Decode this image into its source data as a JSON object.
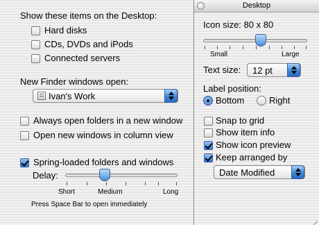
{
  "left": {
    "desktop_heading": "Show these items on the Desktop:",
    "desktop_items": [
      {
        "label": "Hard disks",
        "checked": false
      },
      {
        "label": "CDs, DVDs and iPods",
        "checked": false
      },
      {
        "label": "Connected servers",
        "checked": false
      }
    ],
    "new_window_label": "New Finder windows open:",
    "new_window_value": "Ivan's Work",
    "options": [
      {
        "label": "Always open folders in a new window",
        "checked": false
      },
      {
        "label": "Open new windows in column view",
        "checked": false
      },
      {
        "label": "Spring-loaded folders and windows",
        "checked": true
      }
    ],
    "delay_label": "Delay:",
    "delay_ticks": {
      "short": "Short",
      "medium": "Medium",
      "long": "Long"
    },
    "delay_value_fraction": 0.35,
    "hint": "Press Space Bar to open immediately"
  },
  "right": {
    "window_title": "Desktop",
    "icon_size_label": "Icon size:",
    "icon_size_value": "80 x 80",
    "icon_size_min": "Small",
    "icon_size_max": "Large",
    "icon_size_fraction": 0.55,
    "text_size_label": "Text size:",
    "text_size_value": "12 pt",
    "label_position_label": "Label position:",
    "label_positions": [
      {
        "label": "Bottom",
        "selected": true
      },
      {
        "label": "Right",
        "selected": false
      }
    ],
    "checks": [
      {
        "label": "Snap to grid",
        "checked": false
      },
      {
        "label": "Show item info",
        "checked": false
      },
      {
        "label": "Show icon preview",
        "checked": true
      },
      {
        "label": "Keep arranged by",
        "checked": true
      }
    ],
    "arrange_value": "Date Modified"
  }
}
